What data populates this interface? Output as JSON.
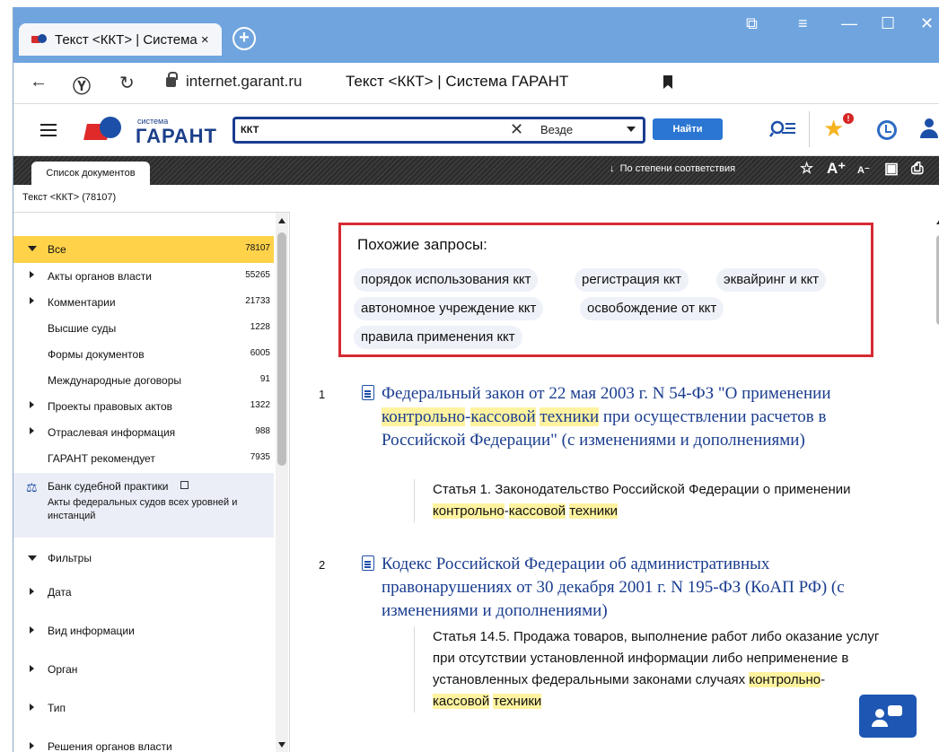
{
  "browser": {
    "tab_title": "Текст <ККТ> | Система ×",
    "url": "internet.garant.ru",
    "page_title": "Текст <ККТ> | Система ГАРАНТ"
  },
  "header": {
    "logo_small": "система",
    "logo_name": "ГАРАНТ",
    "search_value": "ККТ",
    "search_scope": "Везде",
    "find_label": "Найти",
    "favorites_badge": "!"
  },
  "toolbar": {
    "doclist_tab": "Список документов",
    "sort_label": "По степени соответствия",
    "sort_arrow": "↓",
    "font_up": "A⁺",
    "font_down": "A⁻"
  },
  "breadcrumb": "Текст <ККТ> (78107)",
  "sidebar": {
    "categories": [
      {
        "label": "Все",
        "count": "78107"
      },
      {
        "label": "Акты органов власти",
        "count": "55265"
      },
      {
        "label": "Комментарии",
        "count": "21733"
      },
      {
        "label": "Высшие суды",
        "count": "1228"
      },
      {
        "label": "Формы документов",
        "count": "6005"
      },
      {
        "label": "Международные договоры",
        "count": "91"
      },
      {
        "label": "Проекты правовых актов",
        "count": "1322"
      },
      {
        "label": "Отраслевая информация",
        "count": "988"
      },
      {
        "label": "ГАРАНТ рекомендует",
        "count": "7935"
      }
    ],
    "judicial": {
      "title": "Банк судебной практики",
      "subtitle": "Акты федеральных судов всех уровней и инстанций"
    },
    "filters_title": "Фильтры",
    "filters": [
      "Дата",
      "Вид информации",
      "Орган",
      "Тип",
      "Решения органов власти"
    ]
  },
  "similar": {
    "heading": "Похожие запросы:",
    "chips": [
      "порядок использования ккт",
      "регистрация ккт",
      "эквайринг и ккт",
      "автономное учреждение ккт",
      "освобождение от ккт",
      "правила применения ккт"
    ]
  },
  "results": [
    {
      "num": "1",
      "title_a": "Федеральный закон от 22 мая 2003 г. N 54-ФЗ \"О применении ",
      "title_hl1": "контрольно",
      "title_dash": "-",
      "title_hl2": "кассовой",
      "title_sp": " ",
      "title_hl3": "техники",
      "title_b": " при осуществлении расчетов в Российской Федерации\" (с изменениями и дополнениями)",
      "article_a": "Статья 1. Законодательство Российской Федерации о применении ",
      "article_hl1": "контрольно",
      "article_dash": "-",
      "article_hl2": "кассовой",
      "article_sp": " ",
      "article_hl3": "техники"
    },
    {
      "num": "2",
      "title": "Кодекс Российской Федерации об административных правонарушениях от 30 декабря 2001 г. N 195-ФЗ (КоАП РФ) (с изменениями и дополнениями)",
      "article_a": "Статья 14.5. Продажа товаров, выполнение работ либо оказание услуг при отсутствии установленной информации либо неприменение в установленных федеральными законами случаях ",
      "article_hl1": "контрольно",
      "article_dash": "-",
      "article_hl2": "кассовой",
      "article_br": " ",
      "article_hl3": "техники"
    }
  ]
}
